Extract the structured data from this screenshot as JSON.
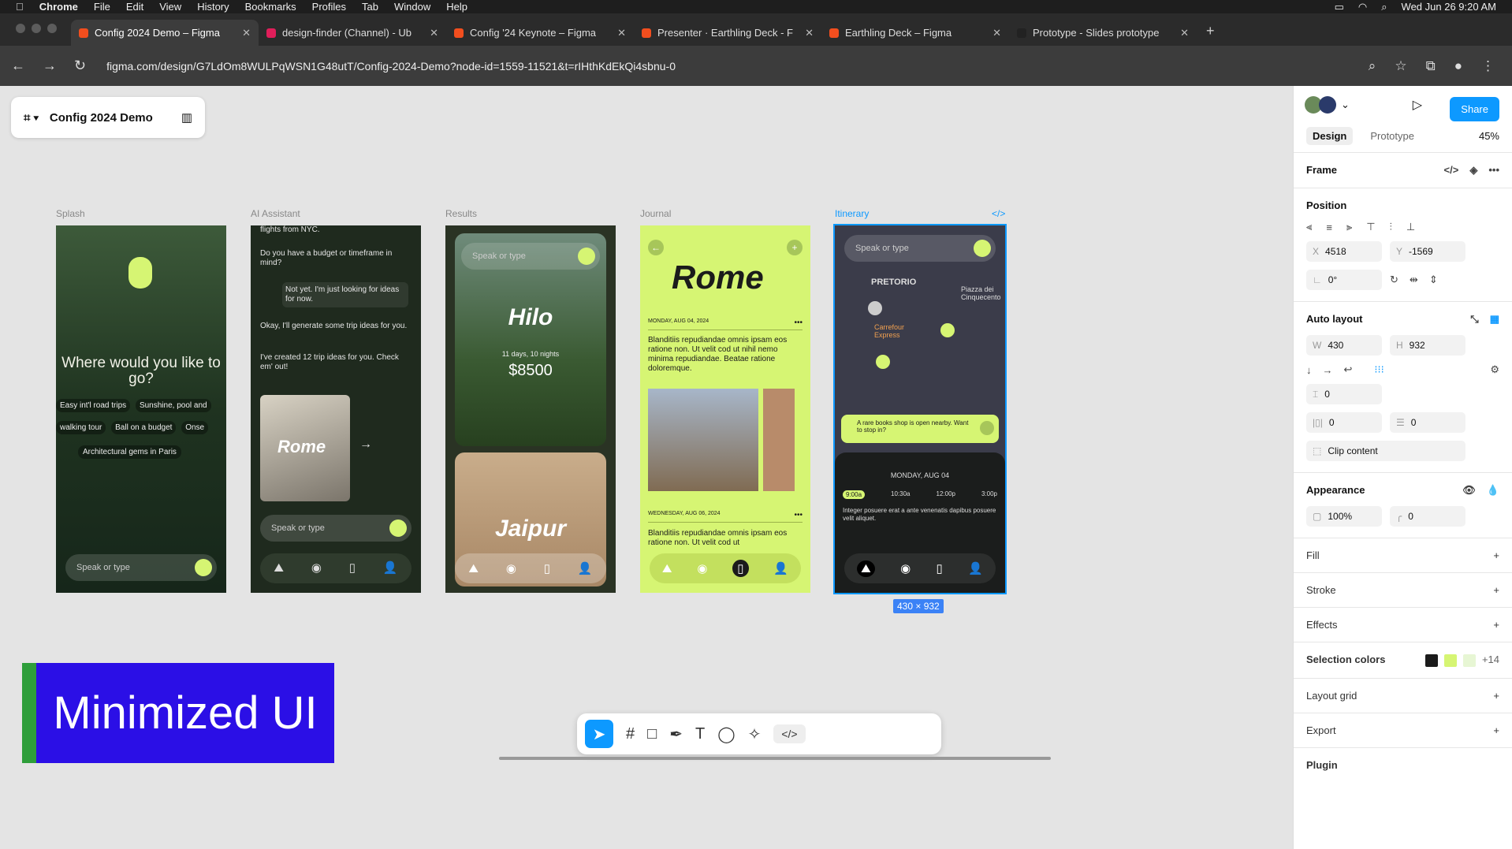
{
  "menubar": {
    "app": "Chrome",
    "items": [
      "File",
      "Edit",
      "View",
      "History",
      "Bookmarks",
      "Profiles",
      "Tab",
      "Window",
      "Help"
    ],
    "clock": "Wed Jun 26  9:20 AM"
  },
  "tabs": [
    {
      "label": "Config 2024 Demo – Figma",
      "active": true,
      "color": "#f24e1e"
    },
    {
      "label": "design-finder (Channel) - Ub",
      "active": false,
      "color": "#e01e5a"
    },
    {
      "label": "Config '24 Keynote – Figma",
      "active": false,
      "color": "#f24e1e"
    },
    {
      "label": "Presenter · Earthling Deck - F",
      "active": false,
      "color": "#f24e1e"
    },
    {
      "label": "Earthling Deck – Figma",
      "active": false,
      "color": "#f24e1e"
    },
    {
      "label": "Prototype - Slides prototype",
      "active": false,
      "color": "#222222"
    }
  ],
  "address": "figma.com/design/G7LdOm8WULPqWSN1G48utT/Config-2024-Demo?node-id=1559-11521&t=rIHthKdEkQi4sbnu-0",
  "file": {
    "title": "Config 2024 Demo"
  },
  "frames": [
    {
      "label": "Splash",
      "headline": "Where would you like to go?",
      "chips": [
        "Easy int'l road trips",
        "Sunshine, pool and",
        "walking tour",
        "Ball on a budget",
        "Onse",
        "Architectural gems in Paris"
      ],
      "input": "Speak or type"
    },
    {
      "label": "AI Assistant",
      "msgs": [
        "flights from NYC.",
        "Do you have a budget or timeframe in mind?",
        "Not yet. I'm just looking for ideas for now.",
        "Okay, I'll generate some trip ideas for you.",
        "I've created 12 trip ideas for you. Check em' out!"
      ],
      "card": "Rome",
      "input": "Speak or type"
    },
    {
      "label": "Results",
      "input": "Speak or type",
      "title1": "Hilo",
      "sub1": "11 days, 10 nights",
      "price": "$8500",
      "title2": "Jaipur"
    },
    {
      "label": "Journal",
      "title": "Rome",
      "date1": "MONDAY, AUG 04, 2024",
      "body1": "Blanditiis repudiandae omnis ipsam eos ratione non. Ut velit cod ut nihil nemo minima repudiandae. Beatae ratione doloremque.",
      "date2": "WEDNESDAY, AUG 06, 2024",
      "body2": "Blanditiis repudiandae omnis ipsam eos ratione non. Ut velit cod ut"
    },
    {
      "label": "Itinerary",
      "input": "Speak or type",
      "map_labels": [
        "PRETORIO",
        "Piazza dei Cinquecento",
        "Carrefour Express"
      ],
      "toast": "A rare books shop is open nearby. Want to stop in?",
      "day": "MONDAY, AUG 04",
      "times": [
        "9:00a",
        "10:30a",
        "12:00p",
        "3:00p"
      ],
      "note": "Integer posuere erat a ante venenatis dapibus posuere velit aliquet."
    }
  ],
  "selection_size": "430 × 932",
  "badge": "Minimized UI",
  "panel": {
    "share": "Share",
    "tabs": [
      "Design",
      "Prototype"
    ],
    "zoom": "45%",
    "frame_label": "Frame",
    "position": {
      "title": "Position",
      "x": "4518",
      "y": "-1569",
      "rotation": "0°"
    },
    "autolayout": {
      "title": "Auto layout",
      "w": "430",
      "h": "932",
      "gap": "0",
      "pad_h": "0",
      "pad_v": "0",
      "clip": "Clip content"
    },
    "appearance": {
      "title": "Appearance",
      "opacity": "100%",
      "radius": "0"
    },
    "fill": "Fill",
    "stroke": "Stroke",
    "effects": "Effects",
    "selection_colors": {
      "title": "Selection colors",
      "colors": [
        "#1b1b1b",
        "#d6f573",
        "#e7f6d4"
      ],
      "more": "+14"
    },
    "layout_grid": "Layout grid",
    "export": "Export",
    "plugin": "Plugin"
  }
}
